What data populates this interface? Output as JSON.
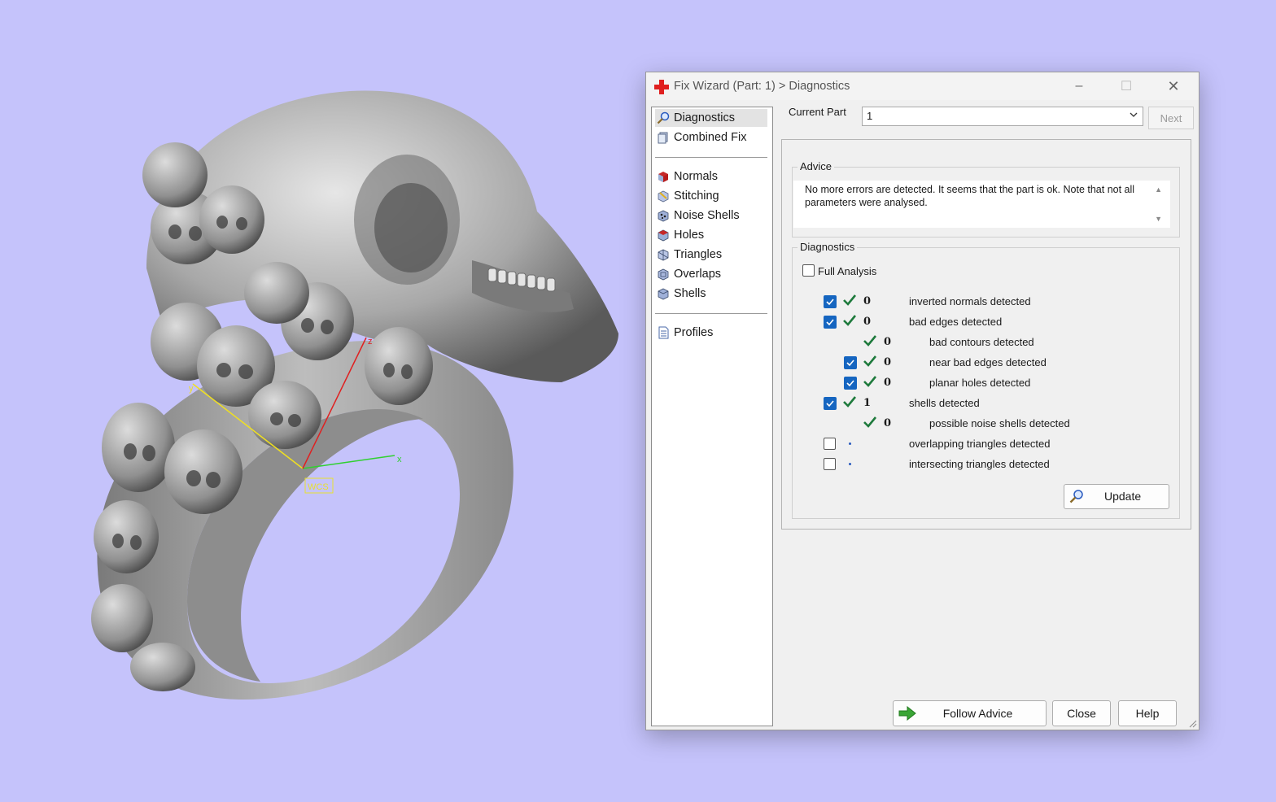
{
  "viewport": {
    "background": "#c5c3fb",
    "wcs_label": "WCS",
    "axis_x": "x",
    "axis_y": "y",
    "axis_z": "z"
  },
  "dialog": {
    "title": "Fix Wizard (Part: 1) > Diagnostics",
    "window_controls": {
      "minimize": "–",
      "maximize": "☐",
      "close": "✕"
    }
  },
  "nav": {
    "group1": [
      {
        "label": "Diagnostics",
        "icon": "magnifier-icon"
      },
      {
        "label": "Combined Fix",
        "icon": "combined-fix-icon"
      }
    ],
    "group2": [
      {
        "label": "Normals",
        "icon": "normals-icon"
      },
      {
        "label": "Stitching",
        "icon": "stitching-icon"
      },
      {
        "label": "Noise Shells",
        "icon": "noise-shells-icon"
      },
      {
        "label": "Holes",
        "icon": "holes-icon"
      },
      {
        "label": "Triangles",
        "icon": "triangles-icon"
      },
      {
        "label": "Overlaps",
        "icon": "overlaps-icon"
      },
      {
        "label": "Shells",
        "icon": "shells-icon"
      }
    ],
    "group3": [
      {
        "label": "Profiles",
        "icon": "profiles-icon"
      }
    ]
  },
  "current_part": {
    "label": "Current Part",
    "value": "1",
    "next_label": "Next"
  },
  "advice": {
    "label": "Advice",
    "text": "No more errors are detected. It seems that the part is ok. Note that not all parameters were analysed."
  },
  "diagnostics": {
    "label": "Diagnostics",
    "full_analysis_label": "Full Analysis",
    "full_analysis_checked": false,
    "rows": [
      {
        "checked": true,
        "status": "ok",
        "count": "0",
        "label": "inverted normals detected"
      },
      {
        "checked": true,
        "status": "ok",
        "count": "0",
        "label": "bad edges detected"
      },
      {
        "checked": null,
        "status": "ok",
        "count": "0",
        "label": "bad contours detected"
      },
      {
        "checked": true,
        "status": "ok",
        "count": "0",
        "label": "near bad edges detected"
      },
      {
        "checked": true,
        "status": "ok",
        "count": "0",
        "label": "planar holes detected"
      },
      {
        "checked": true,
        "status": "ok",
        "count": "1",
        "label": "shells detected"
      },
      {
        "checked": null,
        "status": "ok",
        "count": "0",
        "label": "possible noise shells detected"
      },
      {
        "checked": false,
        "status": "unknown",
        "count": "",
        "label": "overlapping triangles detected"
      },
      {
        "checked": false,
        "status": "unknown",
        "count": "",
        "label": "intersecting triangles detected"
      }
    ],
    "update_label": "Update"
  },
  "buttons": {
    "follow_advice": "Follow Advice",
    "close": "Close",
    "help": "Help"
  },
  "colors": {
    "checkbox": "#1565c0",
    "ok_check": "#1e7a3c",
    "arrow": "#3aa535",
    "title_icon": "#e02020"
  }
}
